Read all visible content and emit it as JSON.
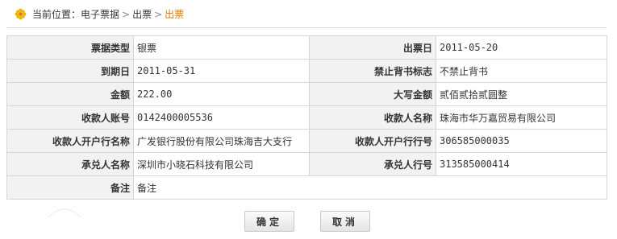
{
  "breadcrumb": {
    "prefix": "当前位置：",
    "items": [
      "电子票据",
      "出票",
      "出票"
    ]
  },
  "form": {
    "rows": [
      {
        "l1": "票据类型",
        "v1": "银票",
        "l2": "出票日",
        "v2": "2011-05-20"
      },
      {
        "l1": "到期日",
        "v1": "2011-05-31",
        "l2": "禁止背书标志",
        "v2": "不禁止背书"
      },
      {
        "l1": "金额",
        "v1": "222.00",
        "l2": "大写金额",
        "v2": "贰佰贰拾贰圆整"
      },
      {
        "l1": "收款人账号",
        "v1": "0142400005536",
        "l2": "收款人名称",
        "v2": "珠海市华万嘉贸易有限公司"
      },
      {
        "l1": "收款人开户行名称",
        "v1": "广发银行股份有限公司珠海吉大支行",
        "l2": "收款人开户行行号",
        "v2": "306585000035"
      },
      {
        "l1": "承兑人名称",
        "v1": "深圳市小晓石科技有限公司",
        "l2": "承兑人行号",
        "v2": "313585000414"
      },
      {
        "l1": "备注",
        "v1": "备注"
      }
    ]
  },
  "buttons": {
    "confirm": "确定",
    "cancel": "取消"
  },
  "colors": {
    "accent": "#e07b00",
    "label_bg": "#f2f2f2",
    "border": "#d6d6d6"
  }
}
